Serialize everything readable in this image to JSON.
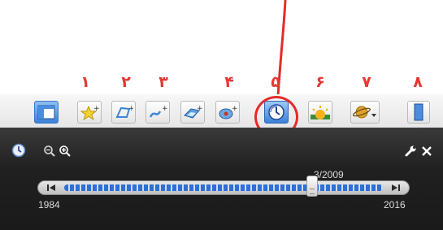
{
  "labels": {
    "n1": "۱",
    "n2": "۲",
    "n3": "۳",
    "n4": "۴",
    "n5": "۵",
    "n6": "۶",
    "n7": "۷",
    "n8": "۸"
  },
  "toolbar": {
    "buttons": [
      {
        "icon": "sidebar-toggle-icon"
      },
      {
        "icon": "add-placemark-icon"
      },
      {
        "icon": "add-polygon-icon"
      },
      {
        "icon": "add-path-icon"
      },
      {
        "icon": "add-image-overlay-icon"
      },
      {
        "icon": "record-tour-icon"
      },
      {
        "icon": "historical-imagery-icon",
        "highlighted": true
      },
      {
        "icon": "sunlight-icon"
      },
      {
        "icon": "switch-planet-icon"
      },
      {
        "icon": "ruler-icon"
      }
    ]
  },
  "timeline": {
    "start_year": "1984",
    "end_year": "2016",
    "current_date": "3/2009",
    "position_fraction": 0.78
  },
  "colors": {
    "accent_red": "#e53935",
    "panel_bg": "#1f1f1f",
    "track_blue": "#2f6fd6"
  }
}
